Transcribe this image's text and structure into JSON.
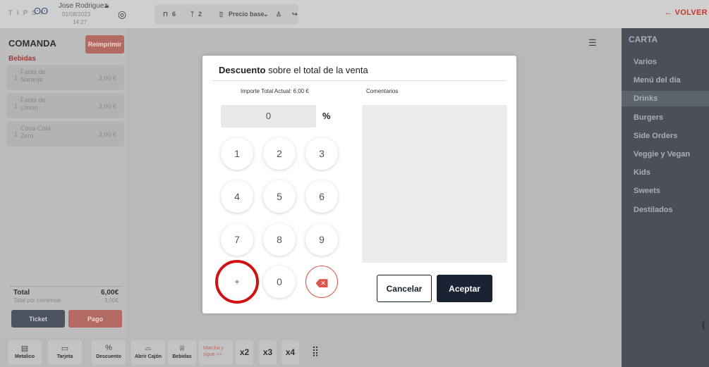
{
  "header": {
    "logo_text": "T I P S I",
    "user_name": "Jose Rodriguez",
    "date": "01/08/2023",
    "time": "14:27",
    "table_count": "6",
    "diners_count": "2",
    "price_mode": "Precio base",
    "back_label": "← VOLVER"
  },
  "order": {
    "title": "COMANDA",
    "reprint_label": "Reimprimir",
    "category": "Bebidas",
    "items": [
      {
        "qty": "1",
        "name": "Fanta de Naranja",
        "price": "2,00 €"
      },
      {
        "qty": "1",
        "name": "Fanta de Limón",
        "price": "2,00 €"
      },
      {
        "qty": "1",
        "name": "Coca-Cola Zero",
        "price": "2,00 €"
      }
    ],
    "total_label": "Total",
    "total_value": "6,00€",
    "per_diner_label": "Total por comensal",
    "per_diner_value": "3,00€",
    "ticket_label": "Ticket",
    "pay_label": "Pago"
  },
  "menu": {
    "title": "CARTA",
    "items": [
      "Varios",
      "Menú del día",
      "Drinks",
      "Burgers",
      "Side Orders",
      "Veggie y Vegan",
      "Kids",
      "Sweets",
      "Destilados"
    ],
    "active": "Drinks"
  },
  "bottom_bar": {
    "items": [
      {
        "label": "Metalico",
        "icon": "cash-icon"
      },
      {
        "label": "Tarjeta",
        "icon": "card-icon"
      },
      {
        "label": "Descuento",
        "icon": "percent-icon"
      },
      {
        "label": "Abrir Cajón",
        "icon": "drawer-icon"
      },
      {
        "label": "Bebidas",
        "icon": "chef-hat-icon"
      }
    ],
    "marcha_label": "Marcha y sigue >>",
    "multipliers": [
      "x2",
      "x3",
      "x4"
    ]
  },
  "modal": {
    "title_bold": "Descuento",
    "title_rest": " sobre el total de la venta",
    "current_total": "Importe Total Actual: 6,00 €",
    "comments_label": "Comentarios",
    "display_value": "0",
    "unit": "%",
    "keys": [
      "1",
      "2",
      "3",
      "4",
      "5",
      "6",
      "7",
      "8",
      "9",
      "+",
      "0"
    ],
    "cancel_label": "Cancelar",
    "accept_label": "Aceptar"
  },
  "colors": {
    "accent_red": "#d40f0f",
    "dark_navy": "#1a2333"
  }
}
